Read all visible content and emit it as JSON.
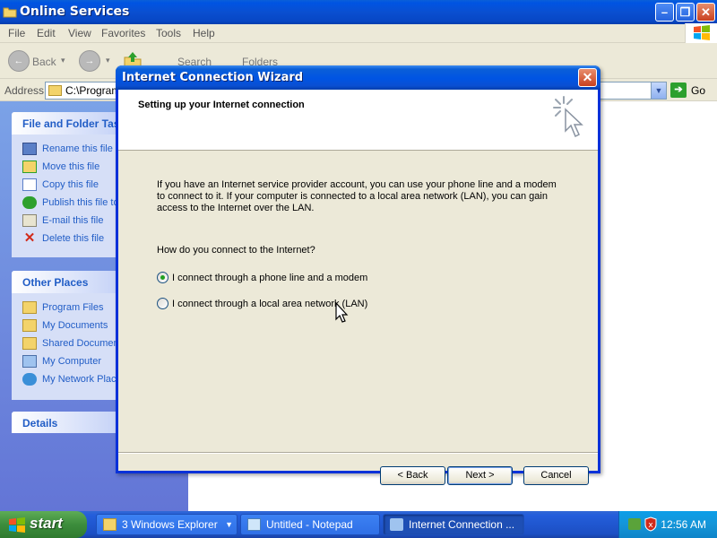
{
  "explorer": {
    "title": "Online Services",
    "menu": [
      "File",
      "Edit",
      "View",
      "Favorites",
      "Tools",
      "Help"
    ],
    "toolbar": {
      "back": "Back",
      "search": "Search",
      "folders": "Folders"
    },
    "address": {
      "label": "Address",
      "value": "C:\\Program",
      "go": "Go"
    },
    "file_tasks": {
      "title": "File and Folder Tasks",
      "items": [
        "Rename this file",
        "Move this file",
        "Copy this file",
        "Publish this file to",
        "E-mail this file",
        "Delete this file"
      ]
    },
    "other_places": {
      "title": "Other Places",
      "items": [
        "Program Files",
        "My Documents",
        "Shared Documents",
        "My Computer",
        "My Network Places"
      ]
    },
    "details": {
      "title": "Details"
    }
  },
  "wizard": {
    "title": "Internet Connection Wizard",
    "close": "✕",
    "heading": "Setting up your Internet connection",
    "intro_lines": [
      "If you have an Internet service provider account, you can use your phone line and a modem",
      "to connect to it. If your computer is connected to a local area network (LAN), you can gain",
      "access to the Internet over the LAN."
    ],
    "question": "How do you connect to the Internet?",
    "options": [
      {
        "label": "I connect through a phone line and a modem",
        "checked": true
      },
      {
        "label": "I connect through a local area network (LAN)",
        "checked": false
      }
    ],
    "buttons": {
      "back": "< Back",
      "next": "Next >",
      "cancel": "Cancel"
    }
  },
  "taskbar": {
    "start": "start",
    "tasks": [
      {
        "label": "3 Windows Explorer",
        "active": false
      },
      {
        "label": "Untitled - Notepad",
        "active": false
      },
      {
        "label": "Internet Connection ...",
        "active": true
      }
    ],
    "clock": "12:56 AM"
  }
}
